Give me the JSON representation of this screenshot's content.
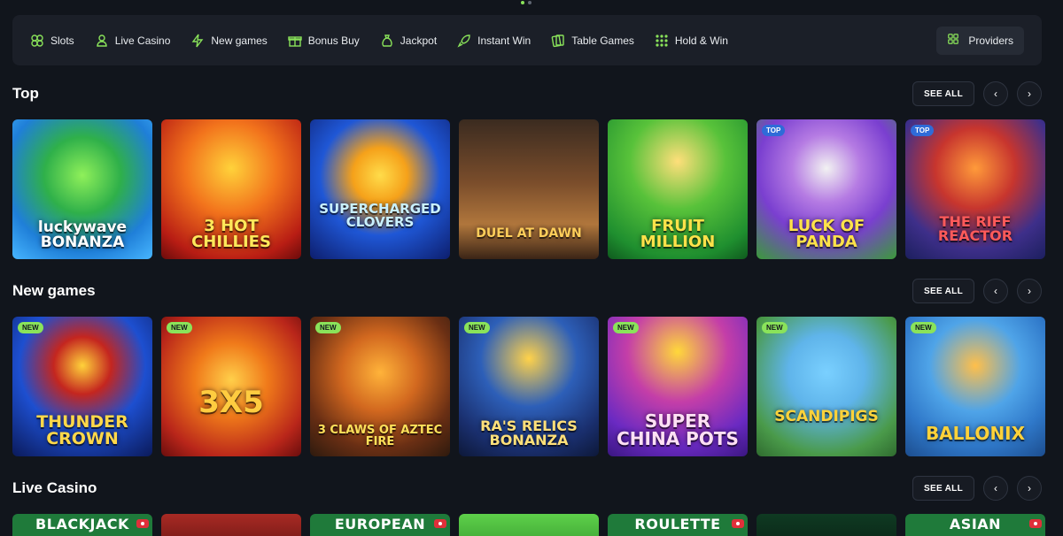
{
  "categories": [
    {
      "label": "Slots",
      "icon": "clover-icon"
    },
    {
      "label": "Live Casino",
      "icon": "dealer-icon"
    },
    {
      "label": "New games",
      "icon": "lightning-icon"
    },
    {
      "label": "Bonus Buy",
      "icon": "gift-icon"
    },
    {
      "label": "Jackpot",
      "icon": "money-bag-icon"
    },
    {
      "label": "Instant Win",
      "icon": "rocket-icon"
    },
    {
      "label": "Table Games",
      "icon": "cards-icon"
    },
    {
      "label": "Hold & Win",
      "icon": "grid-dots-icon"
    }
  ],
  "providers_label": "Providers",
  "see_all_label": "SEE ALL",
  "sections": {
    "top": {
      "title": "Top",
      "games": [
        {
          "title": "luckywave BONANZA",
          "badge": ""
        },
        {
          "title": "3 HOT CHILLIES",
          "badge": ""
        },
        {
          "title": "SUPERCHARGED CLOVERS",
          "badge": ""
        },
        {
          "title": "DUEL AT DAWN",
          "badge": ""
        },
        {
          "title": "FRUIT MILLION",
          "badge": ""
        },
        {
          "title": "LUCK OF PANDA",
          "badge": "TOP"
        },
        {
          "title": "THE RIFF REACTOR",
          "badge": "TOP"
        }
      ]
    },
    "new_games": {
      "title": "New games",
      "games": [
        {
          "title": "THUNDER CROWN",
          "badge": "NEW"
        },
        {
          "title": "3X5",
          "badge": "NEW"
        },
        {
          "title": "3 CLAWS OF AZTEC FIRE",
          "badge": "NEW"
        },
        {
          "title": "RA'S RELICS BONANZA",
          "badge": "NEW"
        },
        {
          "title": "SUPER CHINA POTS",
          "badge": "NEW"
        },
        {
          "title": "SCANDIPIGS",
          "badge": "NEW"
        },
        {
          "title": "BALLONIX",
          "badge": "NEW"
        }
      ]
    },
    "live_casino": {
      "title": "Live Casino",
      "games": [
        {
          "title": "BLACKJACK"
        },
        {
          "title": ""
        },
        {
          "title": "EUROPEAN"
        },
        {
          "title": ""
        },
        {
          "title": "ROULETTE"
        },
        {
          "title": ""
        },
        {
          "title": "ASIAN"
        }
      ]
    }
  },
  "colors": {
    "accent": "#8ae35a",
    "background": "#11151c",
    "panel": "#1b1f28",
    "badge_top": "#2f6bd8"
  }
}
